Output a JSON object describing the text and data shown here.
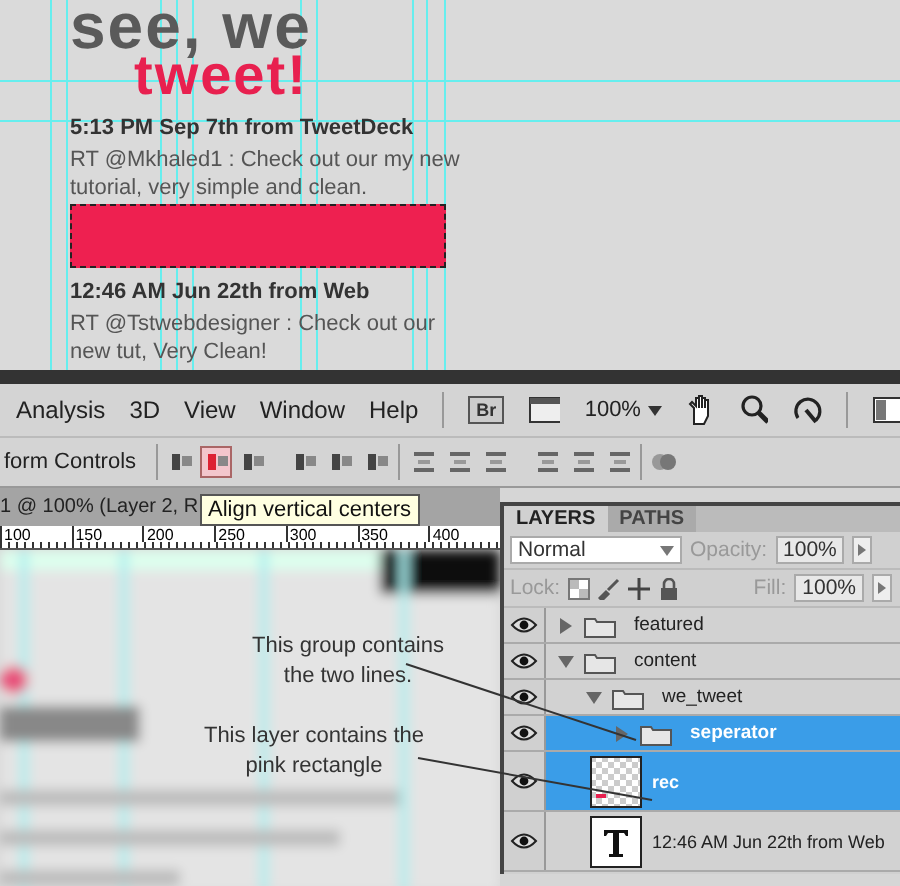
{
  "canvas_top": {
    "heading_line1": "see, we",
    "heading_line2": "tweet!",
    "tweets": [
      {
        "meta": "5:13 PM Sep 7th from TweetDeck",
        "text": "RT @Mkhaled1  : Check out our my new tutorial, very simple and clean."
      },
      {
        "meta": "12:46 AM Jun 22th from Web",
        "text": "RT @Tstwebdesigner  : Check out our new tut, Very Clean!"
      }
    ]
  },
  "menu": [
    "Analysis",
    "3D",
    "View",
    "Window",
    "Help"
  ],
  "toolbar": {
    "bridge_label": "Br",
    "zoom": "100%"
  },
  "options_bar": {
    "label": "form Controls",
    "align_buttons": [
      {
        "selected": false
      },
      {
        "selected": true
      },
      {
        "selected": false
      },
      {
        "selected": false
      },
      {
        "selected": false
      },
      {
        "selected": false
      }
    ],
    "distribute_buttons": [
      {
        "selected": false
      },
      {
        "selected": false
      },
      {
        "selected": false
      },
      {
        "selected": false
      },
      {
        "selected": false
      },
      {
        "selected": false
      }
    ]
  },
  "tooltip": "Align vertical centers",
  "document_tab": "1 @ 100% (Layer 2, R",
  "ruler_ticks": [
    "100",
    "150",
    "200",
    "250",
    "300",
    "350",
    "400"
  ],
  "annotations": [
    "This group contains the two lines.",
    "This layer contains the pink rectangle"
  ],
  "layers_panel": {
    "tabs": [
      {
        "label": "LAYERS",
        "selected": true
      },
      {
        "label": "PATHS",
        "selected": false
      }
    ],
    "blend_mode": "Normal",
    "opacity_label": "Opacity:",
    "opacity": "100%",
    "lock_label": "Lock:",
    "fill_label": "Fill:",
    "fill": "100%",
    "layers": [
      {
        "name": "featured",
        "kind": "group",
        "expanded": false,
        "selected": false,
        "visible": true
      },
      {
        "name": "content",
        "kind": "group",
        "expanded": true,
        "selected": false,
        "visible": true,
        "children": [
          {
            "name": "we_tweet",
            "kind": "group",
            "expanded": true,
            "selected": false,
            "visible": true,
            "children": [
              {
                "name": "seperator",
                "kind": "group",
                "expanded": false,
                "selected": true,
                "visible": true
              },
              {
                "name": "rec",
                "kind": "pixel",
                "selected": true,
                "visible": true
              },
              {
                "name": "12:46 AM Jun 22th from Web",
                "kind": "text",
                "selected": false,
                "visible": true
              }
            ]
          }
        ]
      }
    ]
  }
}
